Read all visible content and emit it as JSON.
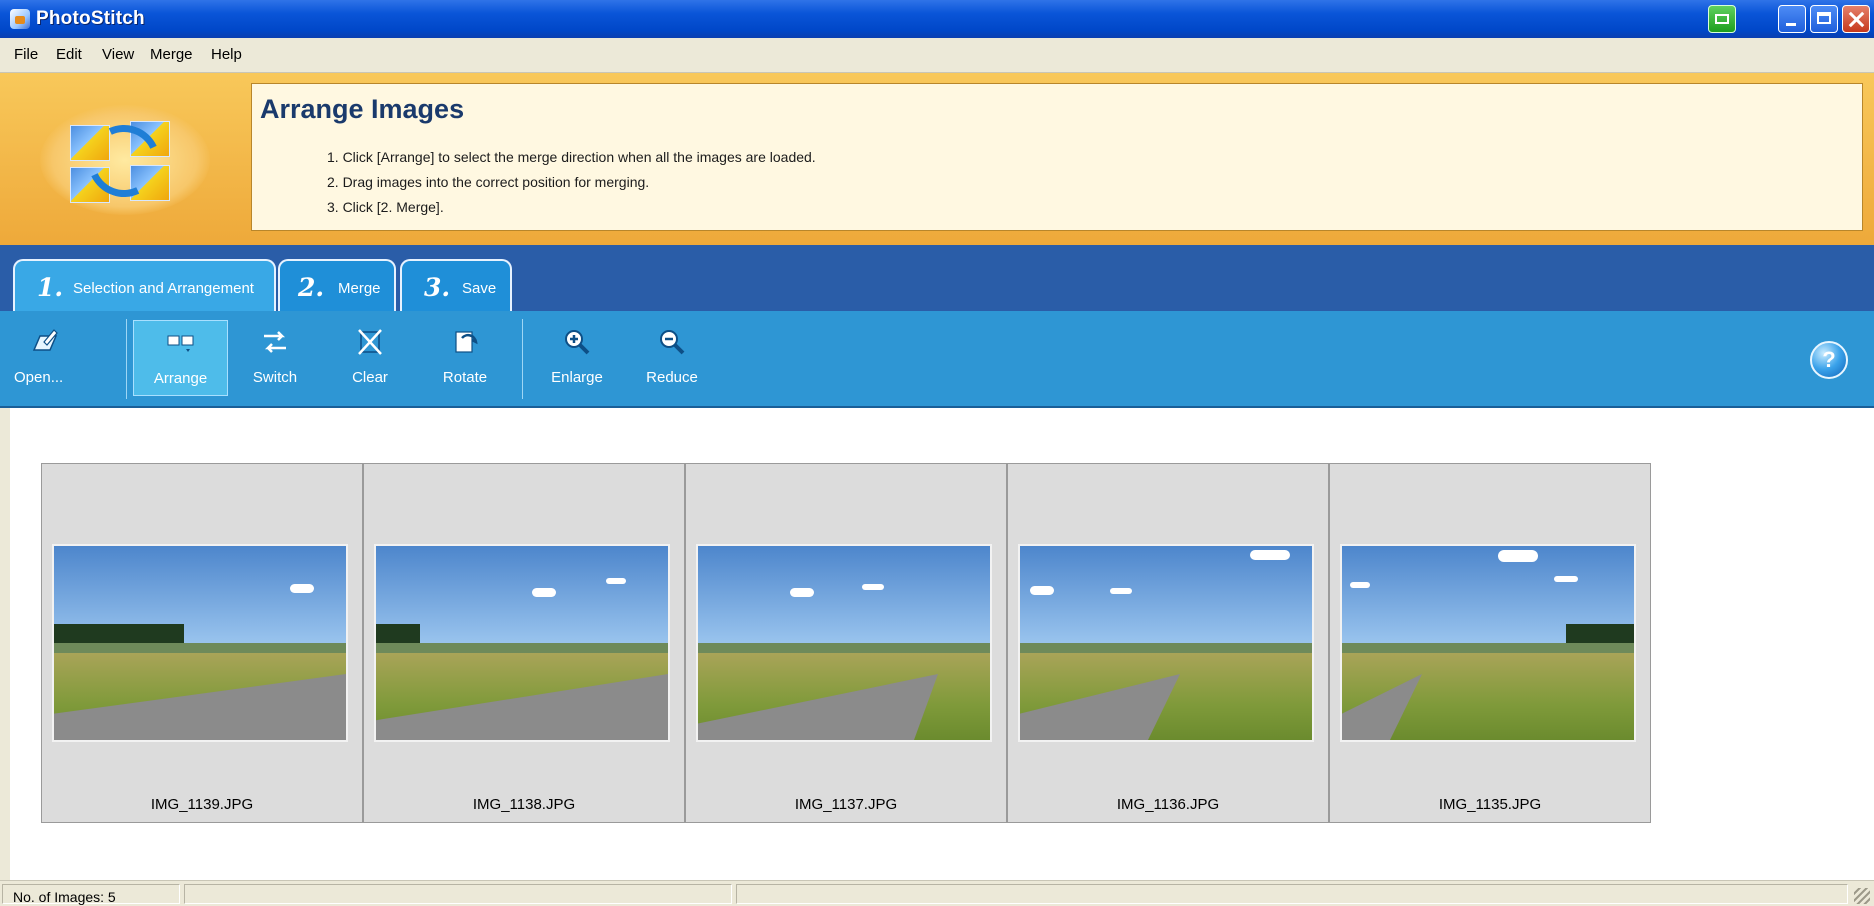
{
  "window": {
    "title": "PhotoStitch"
  },
  "menu": [
    "File",
    "Edit",
    "View",
    "Merge",
    "Help"
  ],
  "header": {
    "title": "Arrange Images",
    "steps": [
      "1. Click [Arrange] to select the merge direction when all the images are loaded.",
      "2. Drag images into the correct position for merging.",
      "3. Click [2. Merge]."
    ]
  },
  "tabs": [
    {
      "num": "1.",
      "label": "Selection and Arrangement",
      "active": true
    },
    {
      "num": "2.",
      "label": "Merge",
      "active": false
    },
    {
      "num": "3.",
      "label": "Save",
      "active": false
    }
  ],
  "toolbar": {
    "open": "Open...",
    "arrange": "Arrange",
    "switch": "Switch",
    "clear": "Clear",
    "rotate": "Rotate",
    "enlarge": "Enlarge",
    "reduce": "Reduce",
    "help": "?"
  },
  "images": [
    {
      "name": "IMG_1139.JPG"
    },
    {
      "name": "IMG_1138.JPG"
    },
    {
      "name": "IMG_1137.JPG"
    },
    {
      "name": "IMG_1136.JPG"
    },
    {
      "name": "IMG_1135.JPG"
    }
  ],
  "status": {
    "count_text": "No. of Images: 5"
  },
  "colors": {
    "title_bar": "#0a55d8",
    "toolbar": "#2e96d4",
    "tab_strip": "#2a5da8",
    "header": "#eea93a"
  },
  "icons": {
    "open": "open-folder-icon",
    "arrange": "arrange-icon",
    "switch": "switch-icon",
    "clear": "clear-icon",
    "rotate": "rotate-icon",
    "enlarge": "zoom-in-icon",
    "reduce": "zoom-out-icon",
    "help": "help-icon"
  }
}
